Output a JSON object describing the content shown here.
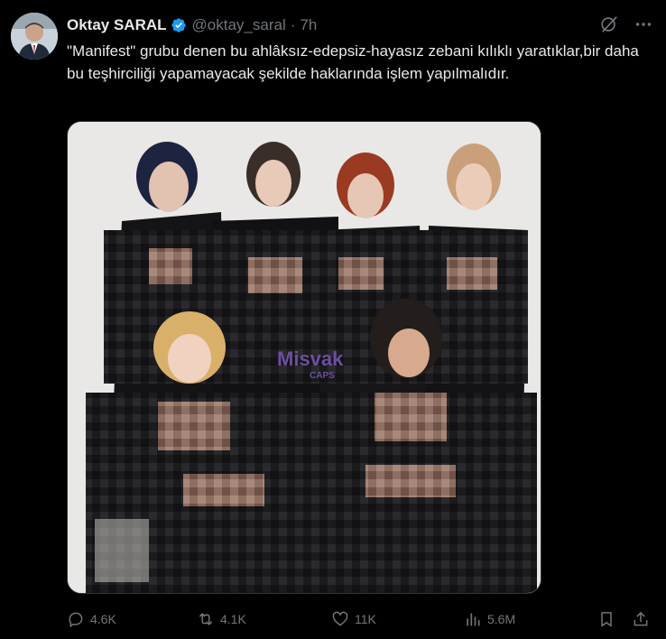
{
  "user": {
    "name": "Oktay SARAL",
    "handle": "@oktay_saral",
    "separator": "·",
    "time": "7h"
  },
  "tweet": {
    "text": "\"Manifest\" grubu denen bu ahlâksız-edepsiz-hayasız zebani kılıklı yaratıklar,bir daha bu teşhirciliği yapamayacak şekilde haklarında işlem yapılmalıdır."
  },
  "media": {
    "watermark_top": "Misvak",
    "watermark_bottom": "CAPS"
  },
  "stats": {
    "replies": "4.6K",
    "reposts": "4.1K",
    "likes": "11K",
    "views": "5.6M"
  },
  "colors": {
    "background": "#000000",
    "text_primary": "#e7e9ea",
    "text_secondary": "#71767b",
    "verified": "#1d9bf0",
    "watermark": "#6b4fa0"
  },
  "icons": [
    "verified-badge-icon",
    "grok-icon",
    "more-icon",
    "reply-icon",
    "repost-icon",
    "like-icon",
    "views-icon",
    "bookmark-icon",
    "share-icon"
  ]
}
